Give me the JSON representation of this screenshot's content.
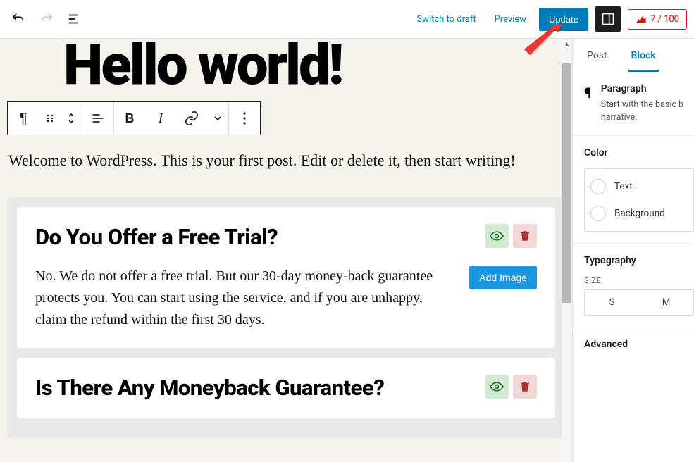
{
  "topbar": {
    "switch_draft": "Switch to draft",
    "preview": "Preview",
    "update": "Update",
    "score": "7 / 100"
  },
  "editor": {
    "title": "Hello world!",
    "paragraph": "Welcome to WordPress. This is your first post. Edit or delete it, then start writing!"
  },
  "faq": {
    "add_image": "Add Image",
    "items": [
      {
        "question": "Do You Offer a Free Trial?",
        "answer": "No. We do not offer a free trial. But our 30-day money-back guarantee protects you. You can start using the service, and if you are unhappy, claim the refund within the first 30 days."
      },
      {
        "question": "Is There Any Moneyback Guarantee?",
        "answer": ""
      }
    ]
  },
  "sidebar": {
    "tabs": {
      "post": "Post",
      "block": "Block"
    },
    "block_type": {
      "title": "Paragraph",
      "desc": "Start with the basic b narrative."
    },
    "color": {
      "heading": "Color",
      "text": "Text",
      "background": "Background"
    },
    "typography": {
      "heading": "Typography",
      "size_label": "SIZE",
      "s": "S",
      "m": "M"
    },
    "advanced": "Advanced"
  }
}
